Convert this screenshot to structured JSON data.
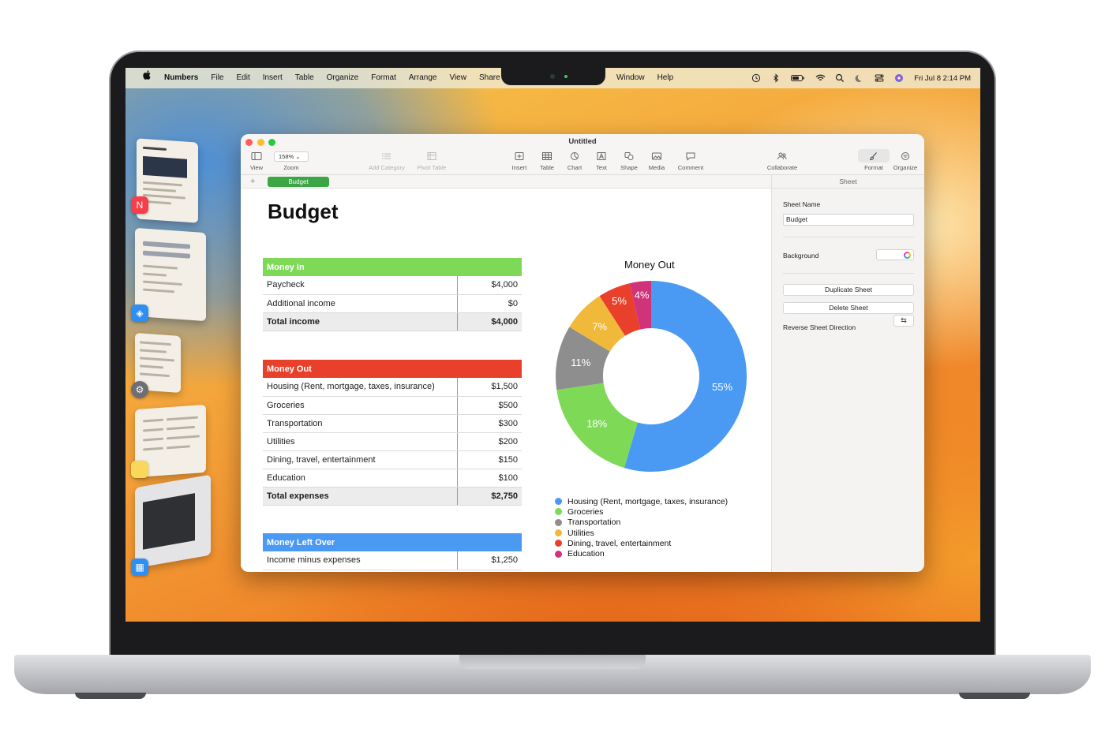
{
  "menubar": {
    "apple": "",
    "app_name": "Numbers",
    "menus": [
      "File",
      "Edit",
      "Insert",
      "Table",
      "Organize",
      "Format",
      "Arrange",
      "View",
      "Share"
    ],
    "menus_right": [
      "Window",
      "Help"
    ],
    "status_icons": [
      "time-machine-icon",
      "bluetooth-icon",
      "battery-icon",
      "wifi-icon",
      "search-icon",
      "focus-moon-icon",
      "control-center-icon",
      "siri-icon"
    ],
    "clock": "Fri Jul 8  2:14 PM"
  },
  "window": {
    "title": "Untitled",
    "toolbar": {
      "view": "View",
      "zoom_value": "158%",
      "zoom": "Zoom",
      "add_category": "Add Category",
      "pivot_table": "Pivot Table",
      "insert": "Insert",
      "table": "Table",
      "chart": "Chart",
      "text": "Text",
      "shape": "Shape",
      "media": "Media",
      "comment": "Comment",
      "collaborate": "Collaborate",
      "format": "Format",
      "organize": "Organize"
    },
    "tab": {
      "add": "+",
      "sheet": "Budget"
    }
  },
  "sheet": {
    "title": "Budget",
    "money_in": {
      "header": "Money In",
      "color": "#7ed957",
      "rows": [
        {
          "label": "Paycheck",
          "value": "$4,000"
        },
        {
          "label": "Additional income",
          "value": "$0"
        }
      ],
      "total": {
        "label": "Total income",
        "value": "$4,000"
      }
    },
    "money_out": {
      "header": "Money Out",
      "color": "#e8402a",
      "rows": [
        {
          "label": "Housing (Rent, mortgage, taxes, insurance)",
          "value": "$1,500"
        },
        {
          "label": "Groceries",
          "value": "$500"
        },
        {
          "label": "Transportation",
          "value": "$300"
        },
        {
          "label": "Utilities",
          "value": "$200"
        },
        {
          "label": "Dining, travel, entertainment",
          "value": "$150"
        },
        {
          "label": "Education",
          "value": "$100"
        }
      ],
      "total": {
        "label": "Total expenses",
        "value": "$2,750"
      }
    },
    "left_over": {
      "header": "Money Left Over",
      "color": "#4a9af4",
      "rows": [
        {
          "label": "Income minus expenses",
          "value": "$1,250"
        }
      ]
    }
  },
  "chart_data": {
    "type": "pie",
    "title": "Money Out",
    "categories": [
      "Housing (Rent, mortgage, taxes, insurance)",
      "Groceries",
      "Transportation",
      "Utilities",
      "Dining, travel, entertainment",
      "Education"
    ],
    "values": [
      1500,
      500,
      300,
      200,
      150,
      100
    ],
    "labels": [
      "55%",
      "18%",
      "11%",
      "7%",
      "5%",
      "4%"
    ],
    "colors": [
      "#4a9af4",
      "#7ed957",
      "#8e8e8e",
      "#f0b93a",
      "#e8402a",
      "#d0337a"
    ],
    "legend": "bottom"
  },
  "inspector": {
    "tab": "Sheet",
    "sheet_name_label": "Sheet Name",
    "sheet_name_value": "Budget",
    "background_label": "Background",
    "duplicate": "Duplicate Sheet",
    "delete": "Delete Sheet",
    "reverse_label": "Reverse Sheet Direction",
    "reverse_icon": "⇆"
  },
  "stage_manager": {
    "apps": [
      "news-app-icon",
      "safari-app-icon",
      "system-settings-app-icon",
      "notes-app-icon",
      "keynote-app-icon"
    ]
  }
}
